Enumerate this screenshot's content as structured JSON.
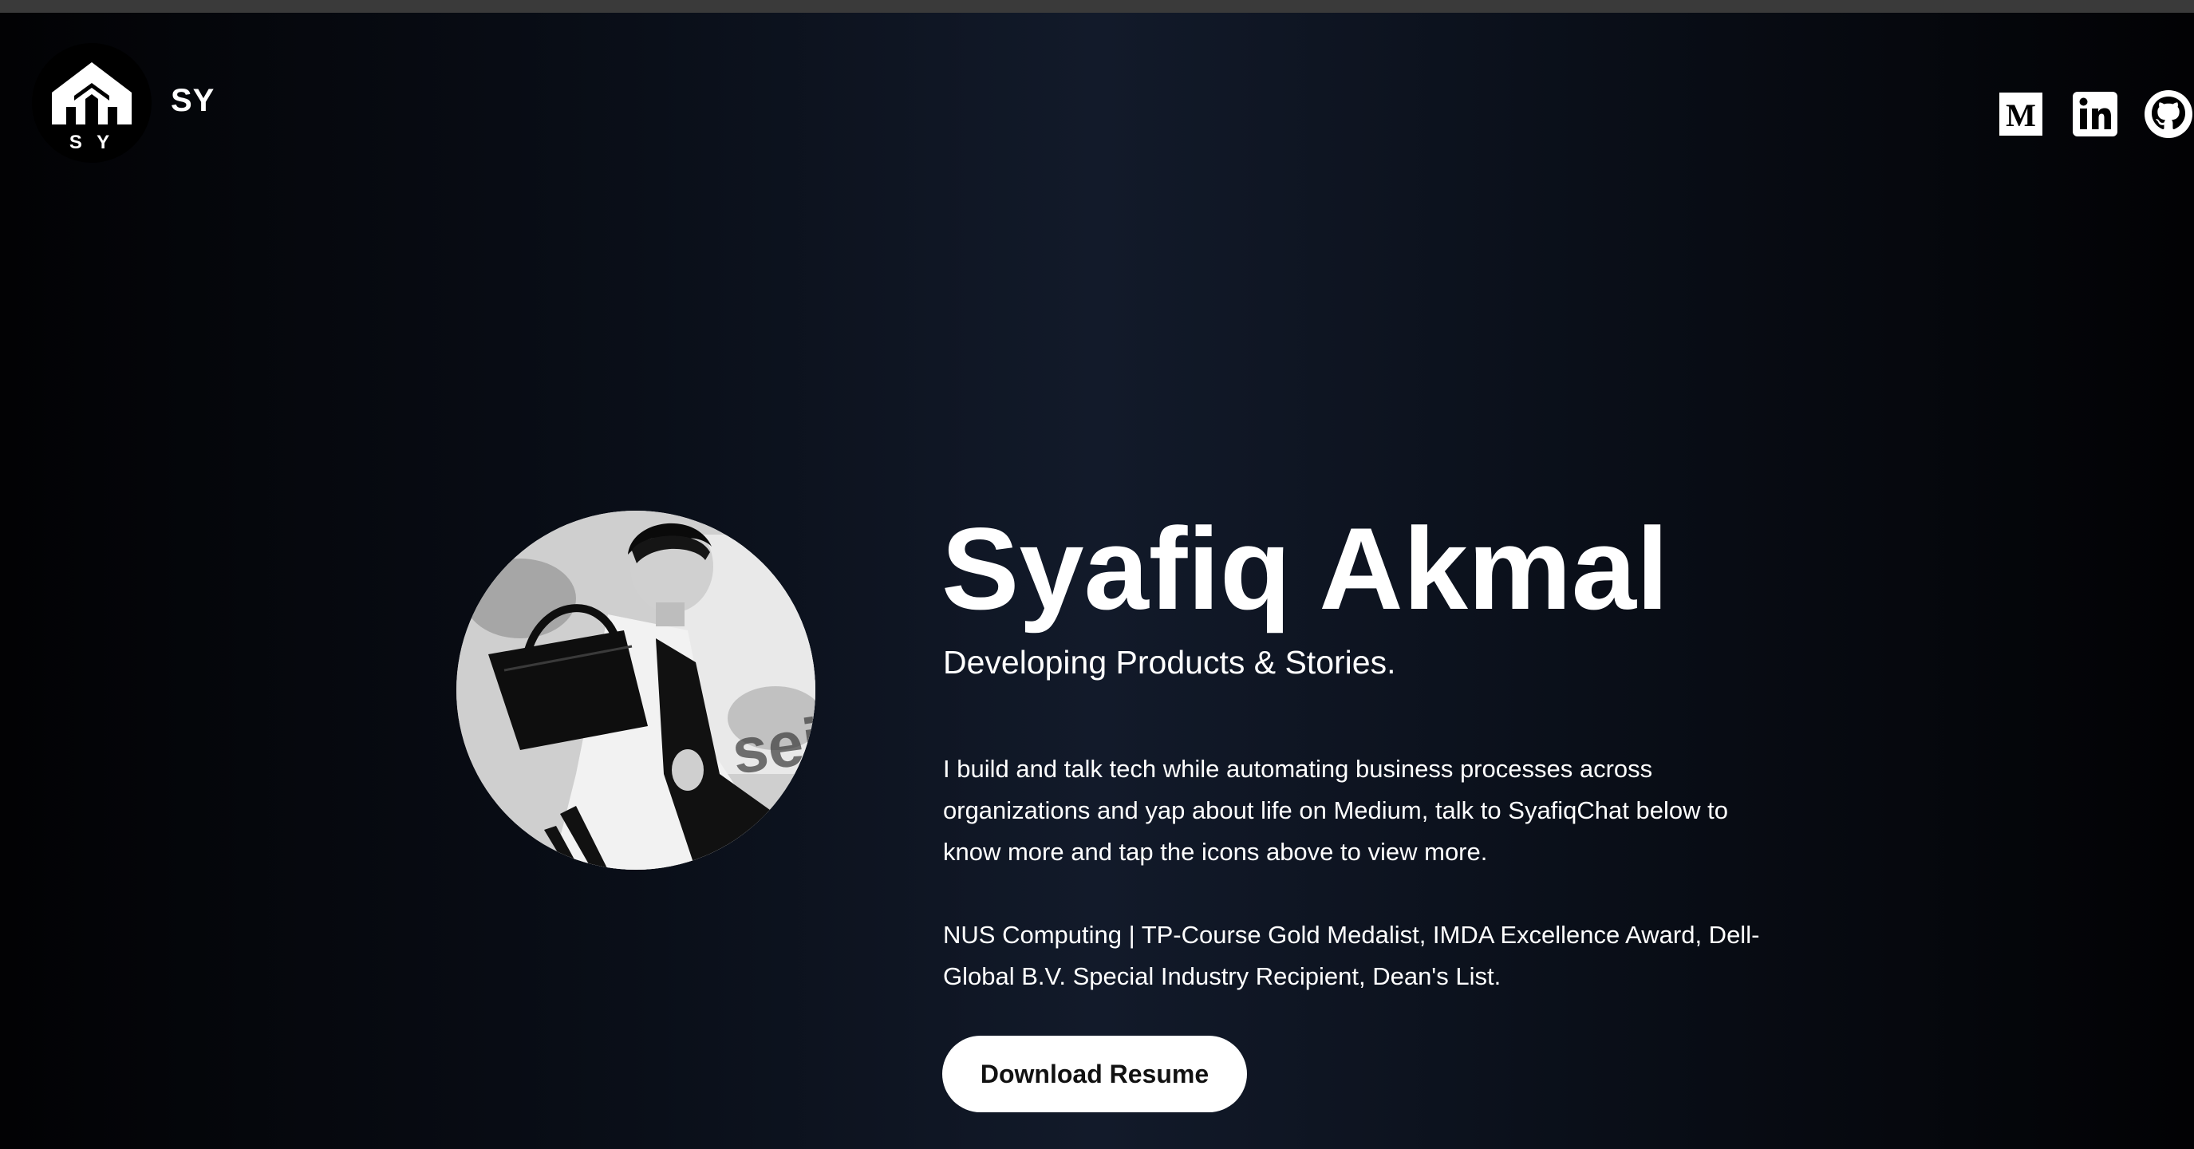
{
  "header": {
    "logo_letters": "S Y",
    "brand": "SY",
    "social": [
      {
        "icon": "medium-icon",
        "label": "M"
      },
      {
        "icon": "linkedin-icon",
        "label": "in"
      },
      {
        "icon": "github-icon",
        "label": ""
      }
    ]
  },
  "hero": {
    "name": "Syafiq Akmal",
    "tagline": "Developing Products & Stories.",
    "bio": "I build and talk tech while automating business processes across organizations and yap about life on Medium, talk to SyafiqChat below to know more and tap the icons above to view more.",
    "credentials": "NUS Computing | TP-Course Gold Medalist, IMDA Excellence Award, Dell-Global B.V. Special Industry Recipient, Dean's List.",
    "resume_button": "Download Resume"
  },
  "colors": {
    "background_dark": "#020204",
    "background_mid": "#121a2a",
    "text": "#ffffff",
    "button_bg": "#ffffff",
    "button_text": "#111111"
  }
}
